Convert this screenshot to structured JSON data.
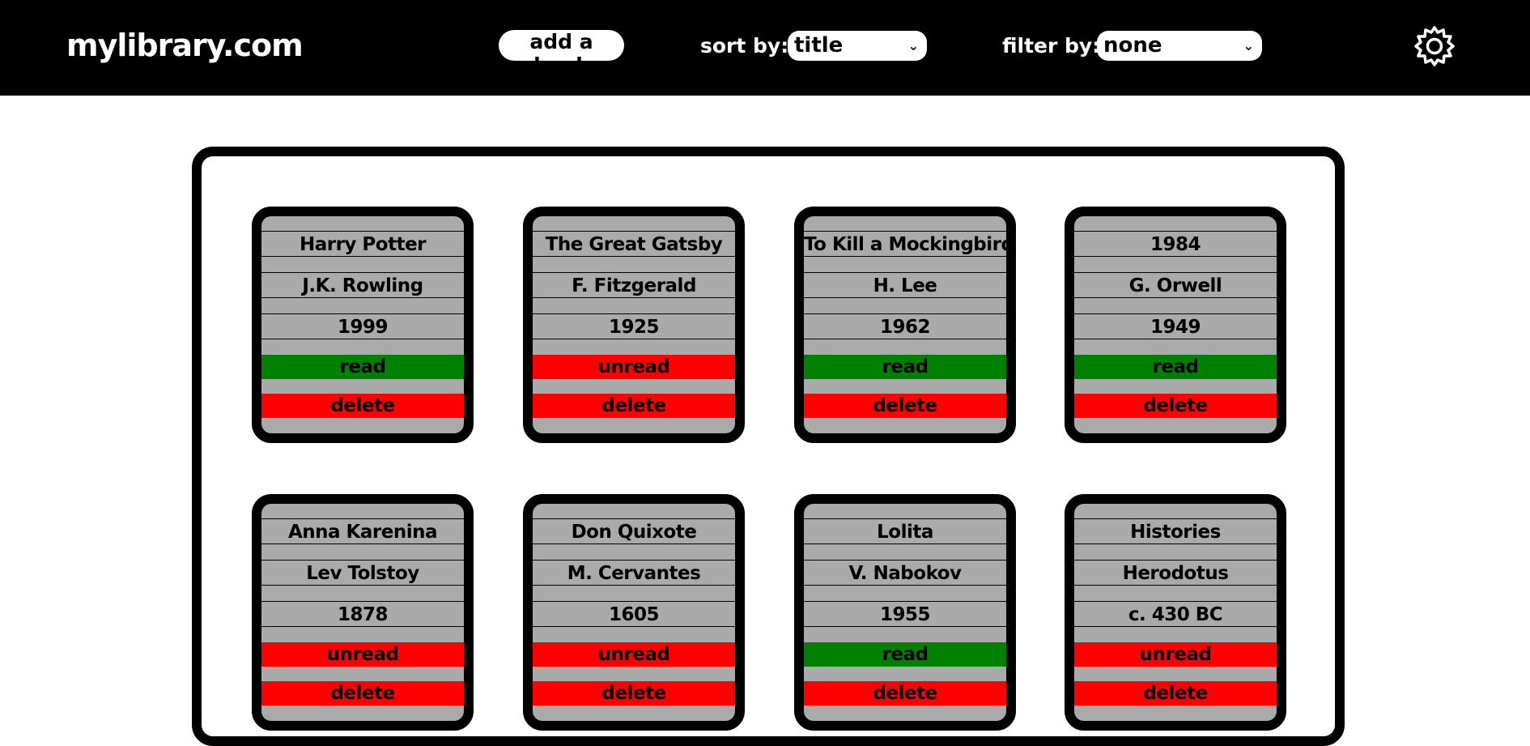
{
  "header": {
    "logo": "mylibrary.com",
    "add_button": "add a book",
    "sort_label": "sort by:",
    "sort_value": "title",
    "filter_label": "filter by:",
    "filter_value": "none",
    "settings_icon": "gear-icon"
  },
  "colors": {
    "header_bg": "#000000",
    "card_bg": "#aaaaaa",
    "read": "#008000",
    "unread": "#ff0000",
    "delete": "#ff0000"
  },
  "books": [
    {
      "title": "Harry Potter",
      "author": "J.K. Rowling",
      "year": "1999",
      "status": "read",
      "delete_label": "delete"
    },
    {
      "title": "The Great Gatsby",
      "author": "F. Fitzgerald",
      "year": "1925",
      "status": "unread",
      "delete_label": "delete"
    },
    {
      "title": "To Kill a Mockingbird",
      "author": "H. Lee",
      "year": "1962",
      "status": "read",
      "delete_label": "delete"
    },
    {
      "title": "1984",
      "author": "G. Orwell",
      "year": "1949",
      "status": "read",
      "delete_label": "delete"
    },
    {
      "title": "Anna Karenina",
      "author": "Lev Tolstoy",
      "year": "1878",
      "status": "unread",
      "delete_label": "delete"
    },
    {
      "title": "Don Quixote",
      "author": "M. Cervantes",
      "year": "1605",
      "status": "unread",
      "delete_label": "delete"
    },
    {
      "title": "Lolita",
      "author": "V. Nabokov",
      "year": "1955",
      "status": "read",
      "delete_label": "delete"
    },
    {
      "title": "Histories",
      "author": "Herodotus",
      "year": "c. 430 BC",
      "status": "unread",
      "delete_label": "delete"
    }
  ]
}
